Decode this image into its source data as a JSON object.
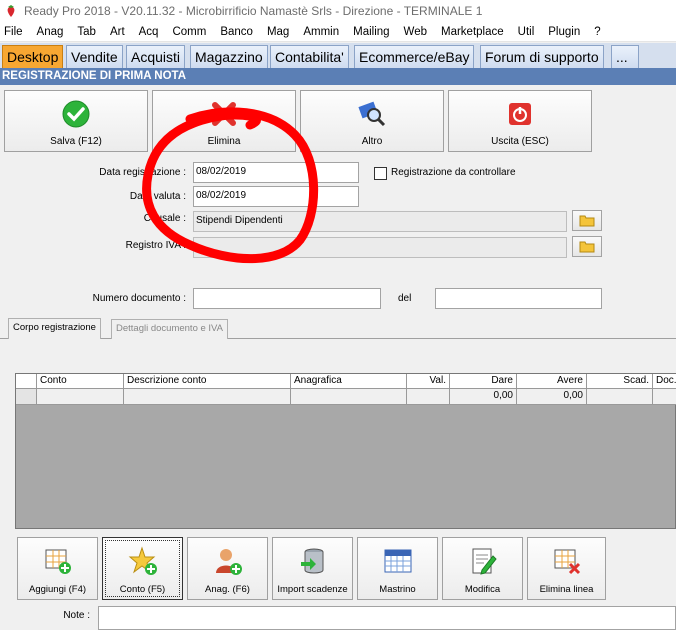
{
  "window": {
    "title": "Ready Pro 2018 - V20.11.32 - Microbirrificio Namastè Srls - Direzione - TERMINALE 1"
  },
  "menu": [
    "File",
    "Anag",
    "Tab",
    "Art",
    "Acq",
    "Comm",
    "Banco",
    "Mag",
    "Ammin",
    "Mailing",
    "Web",
    "Marketplace",
    "Util",
    "Plugin",
    "?"
  ],
  "tabs": [
    "Desktop",
    "Vendite",
    "Acquisti",
    "Magazzino",
    "Contabilita'",
    "Ecommerce/eBay",
    "Forum di supporto",
    "..."
  ],
  "header": {
    "title": "REGISTRAZIONE DI PRIMA NOTA"
  },
  "toolbar": {
    "save": "Salva (F12)",
    "delete": "Elimina",
    "other": "Altro",
    "exit": "Uscita (ESC)"
  },
  "form": {
    "data_registrazione_label": "Data registrazione :",
    "data_registrazione": "08/02/2019",
    "data_valuta_label": "Data valuta :",
    "data_valuta": "08/02/2019",
    "causale_label": "Causale :",
    "causale": "Stipendi Dipendenti",
    "registro_iva_label": "Registro IVA :",
    "registro_iva": "",
    "check_label": "Registrazione da controllare",
    "numero_documento_label": "Numero documento :",
    "numero_documento": "",
    "del_label": "del",
    "del_value": ""
  },
  "subtabs": [
    "Corpo registrazione",
    "Dettagli documento e IVA"
  ],
  "grid": {
    "columns": [
      "",
      "Conto",
      "Descrizione conto",
      "Anagrafica",
      "Val.",
      "Dare",
      "Avere",
      "Scad.",
      "Doc.rif"
    ],
    "row": [
      "",
      "",
      "",
      "",
      "",
      "0,00",
      "0,00",
      "",
      ""
    ]
  },
  "bottom_buttons": [
    "Aggiungi (F4)",
    "Conto (F5)",
    "Anag. (F6)",
    "Import scadenze",
    "Mastrino",
    "Modifica",
    "Elimina linea"
  ],
  "note": {
    "label": "Note :",
    "value": ""
  },
  "colors": {
    "active_tab": "#f7a732",
    "header": "#5b7fb5",
    "annotation": "#ff0000"
  }
}
